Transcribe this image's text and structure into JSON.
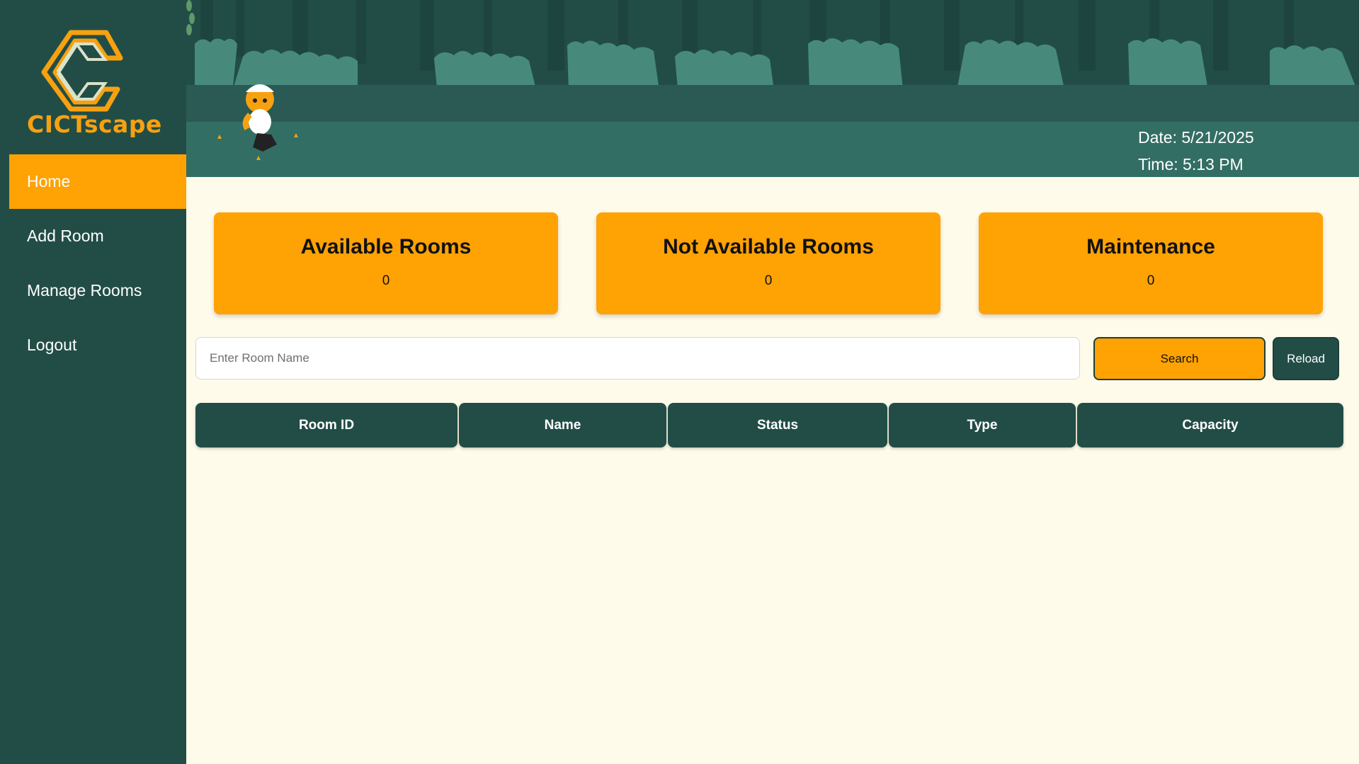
{
  "brand": {
    "name": "CICTscape"
  },
  "sidebar": {
    "items": [
      {
        "label": "Home",
        "active": true
      },
      {
        "label": "Add Room",
        "active": false
      },
      {
        "label": "Manage Rooms",
        "active": false
      },
      {
        "label": "Logout",
        "active": false
      }
    ]
  },
  "header": {
    "date": "Date: 5/21/2025",
    "time": "Time: 5:13 PM"
  },
  "stats": [
    {
      "title": "Available Rooms",
      "value": "0"
    },
    {
      "title": "Not Available Rooms",
      "value": "0"
    },
    {
      "title": "Maintenance",
      "value": "0"
    }
  ],
  "search": {
    "placeholder": "Enter Room Name",
    "value": "",
    "search_label": "Search",
    "reload_label": "Reload"
  },
  "table": {
    "columns": [
      "Room ID",
      "Name",
      "Status",
      "Type",
      "Capacity"
    ],
    "rows": []
  },
  "colors": {
    "sidebar": "#224d47",
    "accent": "#ffa204",
    "background": "#fffbea",
    "header": "#336e64"
  },
  "icons": {
    "logo": "cictscape-logo-icon",
    "mascot": "tiger-mascot-icon"
  }
}
